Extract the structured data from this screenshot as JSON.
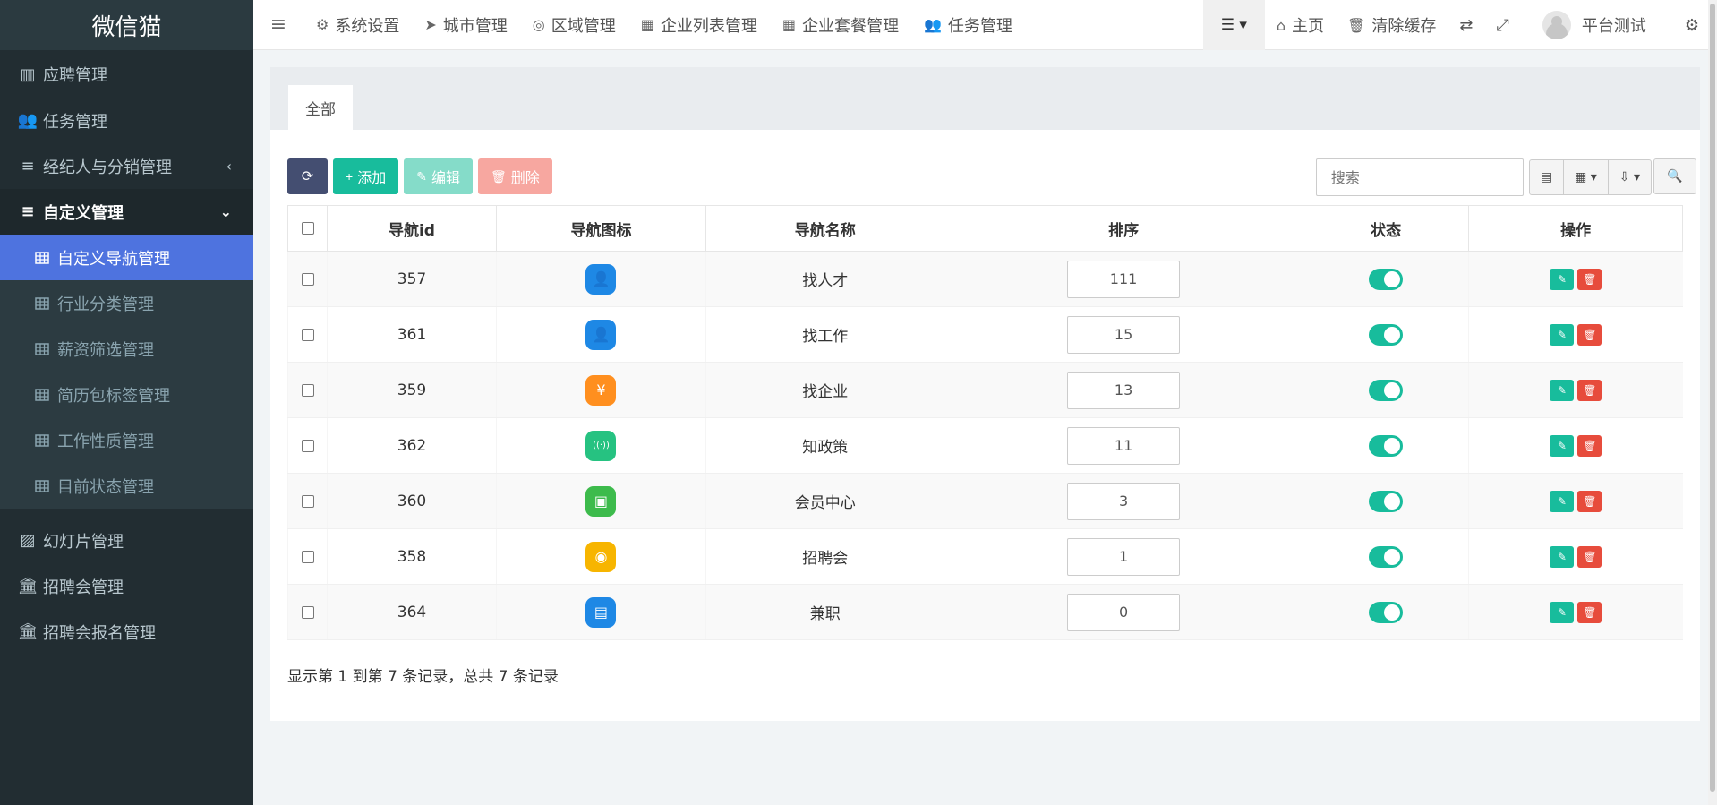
{
  "app": {
    "logo": "微信猫"
  },
  "sidebar": {
    "items": [
      {
        "label": "应聘管理",
        "icon": "map-icon",
        "glyph": "▥",
        "type": "top"
      },
      {
        "label": "任务管理",
        "icon": "users-icon",
        "glyph": "👥",
        "type": "top"
      },
      {
        "label": "经纪人与分销管理",
        "icon": "list-icon",
        "glyph": "≡",
        "type": "top",
        "chevron": "‹"
      },
      {
        "label": "自定义管理",
        "icon": "list-icon",
        "glyph": "≡",
        "type": "open",
        "chevron": "⌄"
      },
      {
        "label": "自定义导航管理",
        "icon": "table-icon",
        "type": "sub-active"
      },
      {
        "label": "行业分类管理",
        "icon": "table-icon",
        "type": "sub"
      },
      {
        "label": "薪资筛选管理",
        "icon": "table-icon",
        "type": "sub"
      },
      {
        "label": "简历包标签管理",
        "icon": "table-icon",
        "type": "sub"
      },
      {
        "label": "工作性质管理",
        "icon": "table-icon",
        "type": "sub"
      },
      {
        "label": "目前状态管理",
        "icon": "table-icon",
        "type": "sub"
      },
      {
        "label": "幻灯片管理",
        "icon": "image-icon",
        "glyph": "▨",
        "type": "top"
      },
      {
        "label": "招聘会管理",
        "icon": "bank-icon",
        "glyph": "🏛",
        "type": "top"
      },
      {
        "label": "招聘会报名管理",
        "icon": "bank-icon",
        "glyph": "🏛",
        "type": "top"
      }
    ]
  },
  "topnav": {
    "toggle_glyph": "≡",
    "items": [
      {
        "label": "系统设置",
        "icon": "cogs-icon",
        "glyph": "⚙"
      },
      {
        "label": "城市管理",
        "icon": "location-arrow-icon",
        "glyph": "➤"
      },
      {
        "label": "区域管理",
        "icon": "compass-icon",
        "glyph": "◎"
      },
      {
        "label": "企业列表管理",
        "icon": "table-icon",
        "glyph": "▦"
      },
      {
        "label": "企业套餐管理",
        "icon": "table-icon",
        "glyph": "▦"
      },
      {
        "label": "任务管理",
        "icon": "users-icon",
        "glyph": "👥"
      }
    ],
    "dropdown_glyph": "☰ ▾",
    "home_label": "主页",
    "home_glyph": "⌂",
    "clear_cache_label": "清除缓存",
    "clear_cache_glyph": "🗑",
    "translate_glyph": "⇄",
    "fullscreen_glyph": "⤢",
    "user_name": "平台测试",
    "settings_glyph": "⚙"
  },
  "tabs": {
    "active": "全部"
  },
  "toolbar": {
    "refresh_glyph": "⟳",
    "add_label": "添加",
    "add_glyph": "+",
    "edit_label": "编辑",
    "edit_glyph": "✎",
    "delete_label": "删除",
    "delete_glyph": "🗑"
  },
  "search": {
    "placeholder": "搜索",
    "button_glyph": "🔍"
  },
  "tools": {
    "toggle_view_glyph": "▤",
    "columns_glyph": "▦ ▾",
    "export_glyph": "⇩ ▾"
  },
  "table": {
    "headers": [
      "导航id",
      "导航图标",
      "导航名称",
      "排序",
      "状态",
      "操作"
    ],
    "rows": [
      {
        "id": "357",
        "name": "找人才",
        "weigh": "111",
        "icon_color": "#1e88e5",
        "icon_glyph": "👤"
      },
      {
        "id": "361",
        "name": "找工作",
        "weigh": "15",
        "icon_color": "#1e88e5",
        "icon_glyph": "👤"
      },
      {
        "id": "359",
        "name": "找企业",
        "weigh": "13",
        "icon_color": "#ff8f1f",
        "icon_glyph": "¥"
      },
      {
        "id": "362",
        "name": "知政策",
        "weigh": "11",
        "icon_color": "#26c281",
        "icon_glyph": "((·))"
      },
      {
        "id": "360",
        "name": "会员中心",
        "weigh": "3",
        "icon_color": "#3dbb4c",
        "icon_glyph": "▣"
      },
      {
        "id": "358",
        "name": "招聘会",
        "weigh": "1",
        "icon_color": "#f7b500",
        "icon_glyph": "◉"
      },
      {
        "id": "364",
        "name": "兼职",
        "weigh": "0",
        "icon_color": "#1e88e5",
        "icon_glyph": "▤"
      }
    ],
    "edit_glyph": "✎",
    "delete_glyph": "🗑"
  },
  "summary": "显示第 1 到第 7 条记录，总共 7 条记录"
}
